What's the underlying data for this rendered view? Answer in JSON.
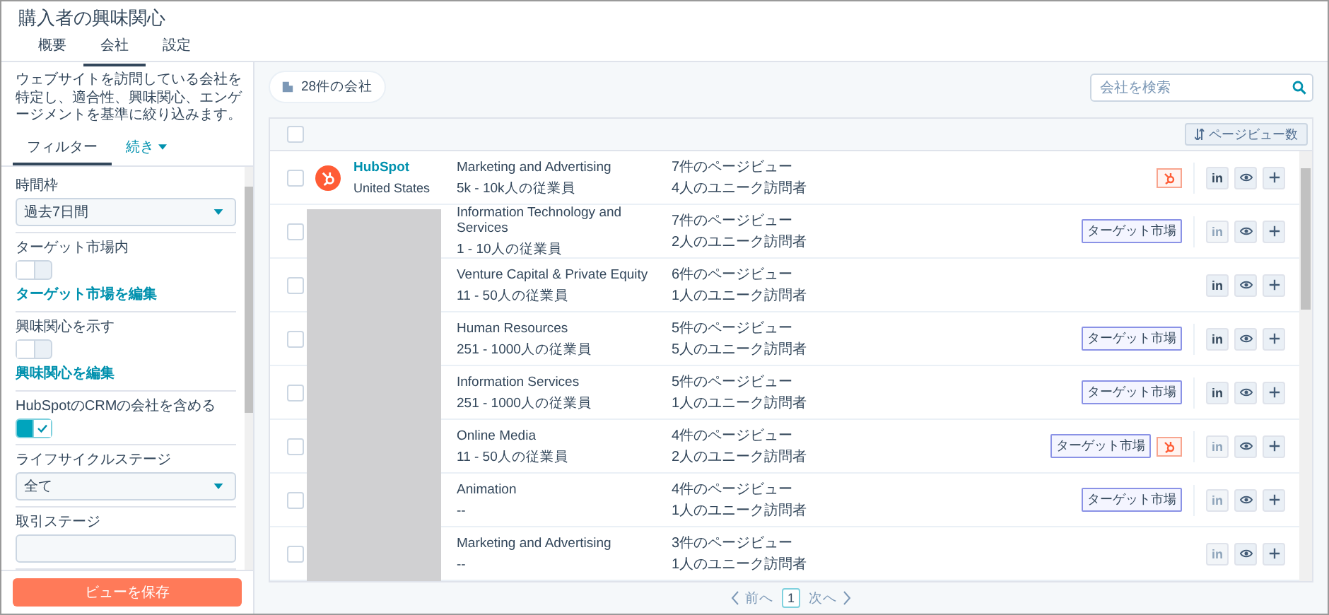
{
  "window": {
    "title": "購入者の興味関心"
  },
  "tabs": [
    {
      "label": "概要",
      "selected": false
    },
    {
      "label": "会社",
      "selected": true
    },
    {
      "label": "設定",
      "selected": false
    }
  ],
  "sidebar": {
    "description": "ウェブサイトを訪問している会社を特定し、適合性、興味関心、エンゲージメントを基準に絞り込みます。",
    "subtabs": [
      {
        "label": "フィルター",
        "selected": true,
        "kind": "tab"
      },
      {
        "label": "続き",
        "selected": false,
        "kind": "menu"
      }
    ],
    "filters": [
      {
        "kind": "dropdown",
        "label": "時間枠",
        "value": "過去7日間"
      },
      {
        "kind": "toggle",
        "label": "ターゲット市場内",
        "on": false,
        "link": "ターゲット市場を編集"
      },
      {
        "kind": "toggle",
        "label": "興味関心を示す",
        "on": false,
        "link": "興味関心を編集"
      },
      {
        "kind": "toggle",
        "label": "HubSpotのCRMの会社を含める",
        "on": true
      },
      {
        "kind": "dropdown",
        "label": "ライフサイクルステージ",
        "value": "全て"
      },
      {
        "kind": "dropdown",
        "label": "取引ステージ"
      }
    ],
    "save_button": "ビューを保存"
  },
  "toolbar": {
    "count": "28件の会社",
    "search": {
      "placeholder": "会社を検索"
    }
  },
  "table": {
    "all_checked": false,
    "sort_button": "ページビュー数",
    "redacted": true,
    "rows": [
      {
        "checked": false,
        "company": {
          "name": "HubSpot",
          "country": "United States"
        },
        "industry": "Marketing and Advertising",
        "size": "5k - 10k人の従業員",
        "pageviews": "7件のページビュー",
        "visitors": "4人のユニーク訪問者",
        "tags": [
          {
            "kind": "hubspot"
          }
        ],
        "linkedin": {
          "label": "in",
          "disabled": false
        }
      },
      {
        "checked": false,
        "industry": "Information Technology and Services",
        "size": "1 - 10人の従業員",
        "pageviews": "7件のページビュー",
        "visitors": "2人のユニーク訪問者",
        "tags": [
          {
            "kind": "target",
            "label": "ターゲット市場"
          }
        ],
        "linkedin": {
          "label": "in",
          "disabled": true
        }
      },
      {
        "checked": false,
        "industry": "Venture Capital & Private Equity",
        "size": "11 - 50人の従業員",
        "pageviews": "6件のページビュー",
        "visitors": "1人のユニーク訪問者",
        "tags": [],
        "linkedin": {
          "label": "in",
          "disabled": false
        }
      },
      {
        "checked": false,
        "industry": "Human Resources",
        "size": "251 - 1000人の従業員",
        "pageviews": "5件のページビュー",
        "visitors": "5人のユニーク訪問者",
        "tags": [
          {
            "kind": "target",
            "label": "ターゲット市場"
          }
        ],
        "linkedin": {
          "label": "in",
          "disabled": false
        }
      },
      {
        "checked": false,
        "industry": "Information Services",
        "size": "251 - 1000人の従業員",
        "pageviews": "5件のページビュー",
        "visitors": "1人のユニーク訪問者",
        "tags": [
          {
            "kind": "target",
            "label": "ターゲット市場"
          }
        ],
        "linkedin": {
          "label": "in",
          "disabled": false
        }
      },
      {
        "checked": false,
        "industry": "Online Media",
        "size": "11 - 50人の従業員",
        "pageviews": "4件のページビュー",
        "visitors": "2人のユニーク訪問者",
        "tags": [
          {
            "kind": "target",
            "label": "ターゲット市場"
          },
          {
            "kind": "hubspot"
          }
        ],
        "linkedin": {
          "label": "in",
          "disabled": true
        }
      },
      {
        "checked": false,
        "industry": "Animation",
        "size": "--",
        "pageviews": "4件のページビュー",
        "visitors": "1人のユニーク訪問者",
        "tags": [
          {
            "kind": "target",
            "label": "ターゲット市場"
          }
        ],
        "linkedin": {
          "label": "in",
          "disabled": true
        }
      },
      {
        "checked": false,
        "industry": "Marketing and Advertising",
        "size": "--",
        "pageviews": "3件のページビュー",
        "visitors": "1人のユニーク訪問者",
        "tags": [],
        "linkedin": {
          "label": "in",
          "disabled": true
        }
      }
    ]
  },
  "pagination": {
    "prev": "前へ",
    "page": "1",
    "next": "次へ"
  }
}
